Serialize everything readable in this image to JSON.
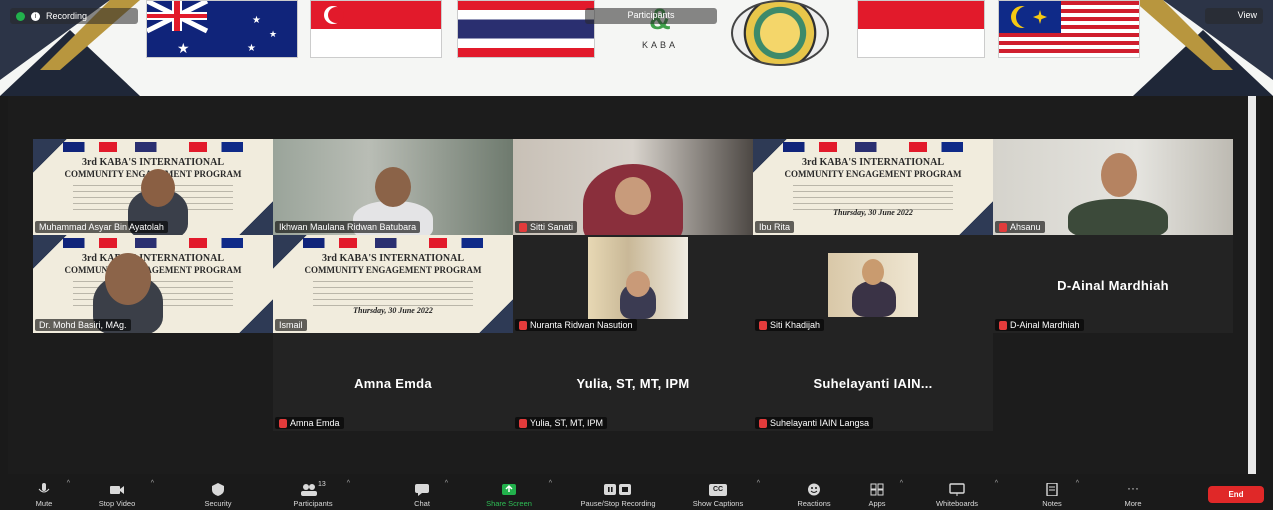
{
  "top_bar": {
    "left_label": "Recording",
    "center_label": "Participants",
    "right_label": "View"
  },
  "banner": {
    "logo_text": "KABA",
    "logo_sub": "",
    "logo_mark": "&"
  },
  "slide_text": {
    "title_line1": "3rd KABA'S INTERNATIONAL",
    "title_line2": "COMMUNITY ENGAGEMENT PROGRAM",
    "date": "Thursday, 30 June 2022"
  },
  "tiles": [
    {
      "id": "muhammad-asyar",
      "name": "Muhammad Asyar Bin Ayatolah",
      "type": "slide-video"
    },
    {
      "id": "speaker-2",
      "name": "Ikhwan Maulana Ridwan Batubara",
      "type": "video"
    },
    {
      "id": "sitti",
      "name": "Sitti Sanati",
      "type": "video"
    },
    {
      "id": "slide-share",
      "name": "Ibu Rita",
      "type": "slide"
    },
    {
      "id": "ahsanu",
      "name": "Ahsanu",
      "type": "video"
    },
    {
      "id": "mahdi",
      "name": "Dr. Mohd Basiri, MAg.",
      "type": "slide-video"
    },
    {
      "id": "slide-2",
      "name": "Ismail",
      "type": "slide"
    },
    {
      "id": "nuranta",
      "name": "Nuranta Ridwan Nasution",
      "type": "small-video"
    },
    {
      "id": "siti-khadijah",
      "name": "Siti Khadijah",
      "type": "small-video"
    },
    {
      "id": "d-ainal",
      "name": "D-Ainal Mardhiah",
      "display": "D-Ainal Mardhiah",
      "type": "name"
    },
    {
      "id": "amna",
      "name": "Amna Emda",
      "display": "Amna Emda",
      "type": "name"
    },
    {
      "id": "yulia",
      "name": "Yulia, ST, MT, IPM",
      "display": "Yulia, ST, MT, IPM",
      "type": "name"
    },
    {
      "id": "suhelayanti",
      "name": "Suhelayanti  IAIN Langsa",
      "display": "Suhelayanti  IAIN...",
      "type": "name"
    }
  ],
  "toolbar": {
    "mute": "Mute",
    "stop_video": "Stop Video",
    "security": "Security",
    "participants": "Participants",
    "participants_count": "13",
    "chat": "Chat",
    "share_screen": "Share Screen",
    "pause_recording": "Pause/Stop Recording",
    "captions": "Show Captions",
    "captions_badge": "CC",
    "reactions": "Reactions",
    "apps": "Apps",
    "whiteboards": "Whiteboards",
    "notes": "Notes",
    "more": "More",
    "end": "End"
  },
  "colors": {
    "accent_green": "#22b14c",
    "end_red": "#e02828",
    "mute_red": "#e23b3b"
  }
}
